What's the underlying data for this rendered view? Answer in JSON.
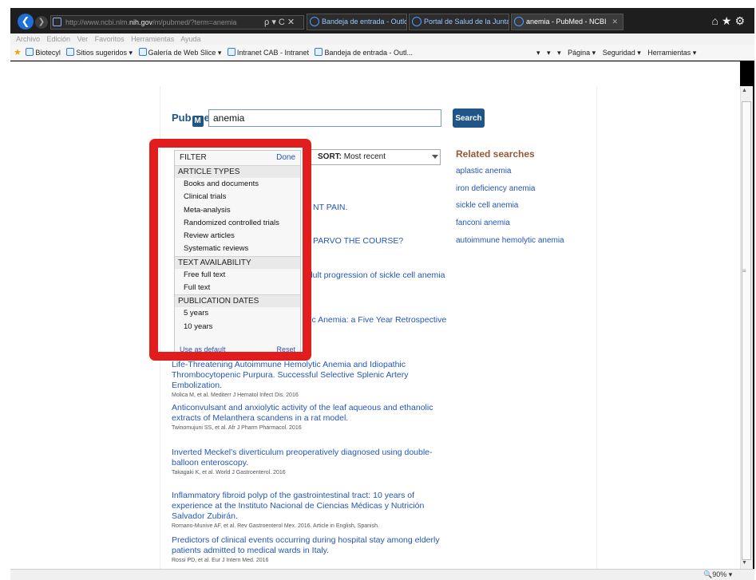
{
  "browser": {
    "address_prefix": "http://www.ncbi.nlm.",
    "address_host": "nih.gov",
    "address_suffix": "/m/pubmed/?term=anemia",
    "address_tools": "ρ ▾ C ✕",
    "tabs": [
      {
        "label": "Bandeja de entrada - Outlook ..."
      },
      {
        "label": "Portal de Salud de la Junta de ..."
      },
      {
        "label": "anemia - PubMed - NCBI"
      }
    ],
    "tab_close": "✕",
    "topright_icons": "⌂★⚙",
    "menu": [
      "Archivo",
      "Edición",
      "Ver",
      "Favoritos",
      "Herramientas",
      "Ayuda"
    ],
    "favorites": [
      "Biotecyl",
      "Sitios sugeridos ▾",
      "Galería de Web Slice ▾",
      "Intranet CAB - Intranet",
      "Bandeja de entrada - Outl..."
    ],
    "command_bar": [
      "▾",
      "▾",
      "▾",
      "Página ▾",
      "Seguridad ▾",
      "Herramientas ▾"
    ],
    "zoom": "🔍90%  ▾"
  },
  "pubmed": {
    "logo_left": "Pub",
    "logo_mark": "M",
    "logo_right": "ed",
    "search_value": "anemia",
    "search_button": "Search",
    "sort_label": "SORT:",
    "sort_value": "Most recent",
    "filter": {
      "title": "FILTER",
      "done": "Done",
      "sections": [
        {
          "heading": "ARTICLE TYPES",
          "items": [
            "Books and documents",
            "Clinical trials",
            "Meta-analysis",
            "Randomized controlled trials",
            "Review articles",
            "Systematic reviews"
          ]
        },
        {
          "heading": "TEXT AVAILABILITY",
          "items": [
            "Free full text",
            "Full text"
          ]
        },
        {
          "heading": "PUBLICATION DATES",
          "items": [
            "5 years",
            "10 years"
          ]
        }
      ],
      "footer_left": "Use as default",
      "footer_right": "Reset"
    },
    "related_title": "Related searches",
    "related": [
      "aplastic anemia",
      "iron deficiency anemia",
      "sickle cell anemia",
      "fanconi anemia",
      "autoimmune hemolytic anemia"
    ],
    "partial_titles": [
      "NT PAIN.",
      "PARVO THE COURSE?",
      "adult progression of sickle cell anemia",
      "stic Anemia: a Five Year Retrospective"
    ],
    "results": [
      {
        "title": "Life-Threatening Autoimmune Hemolytic Anemia and Idiopathic Thrombocytopenic Purpura. Successful Selective Splenic Artery Embolization.",
        "meta": "Molica M, et al. Mediterr J Hematol Infect Dis. 2016"
      },
      {
        "title": "Anticonvulsant and anxiolytic activity of the leaf aqueous and ethanolic extracts of Melanthera scandens in a rat model.",
        "meta": "Twinomujuni SS, et al. Afr J Pharm Pharmacol. 2016"
      },
      {
        "title": "Inverted Meckel's diverticulum preoperatively diagnosed using double-balloon enteroscopy.",
        "meta": "Takagaki K, et al. World J Gastroenterol. 2016"
      },
      {
        "title": "Inflammatory fibroid polyp of the gastrointestinal tract: 10 years of experience at the Instituto Nacional de Ciencias Médicas y Nutrición Salvador Zubirán.",
        "meta": "Romano-Munive AF, et al. Rev Gastroenterol Mex. 2016. Article in English, Spanish."
      },
      {
        "title": "Predictors of clinical events occurring during hospital stay among elderly patients admitted to medical wards in Italy.",
        "meta": "Rossi PD, et al. Eur J Intern Med. 2016"
      }
    ]
  },
  "colors": {
    "highlight": "#e21d1d",
    "link": "#2456b4",
    "brand": "#20558a",
    "related_heading": "#985735"
  }
}
